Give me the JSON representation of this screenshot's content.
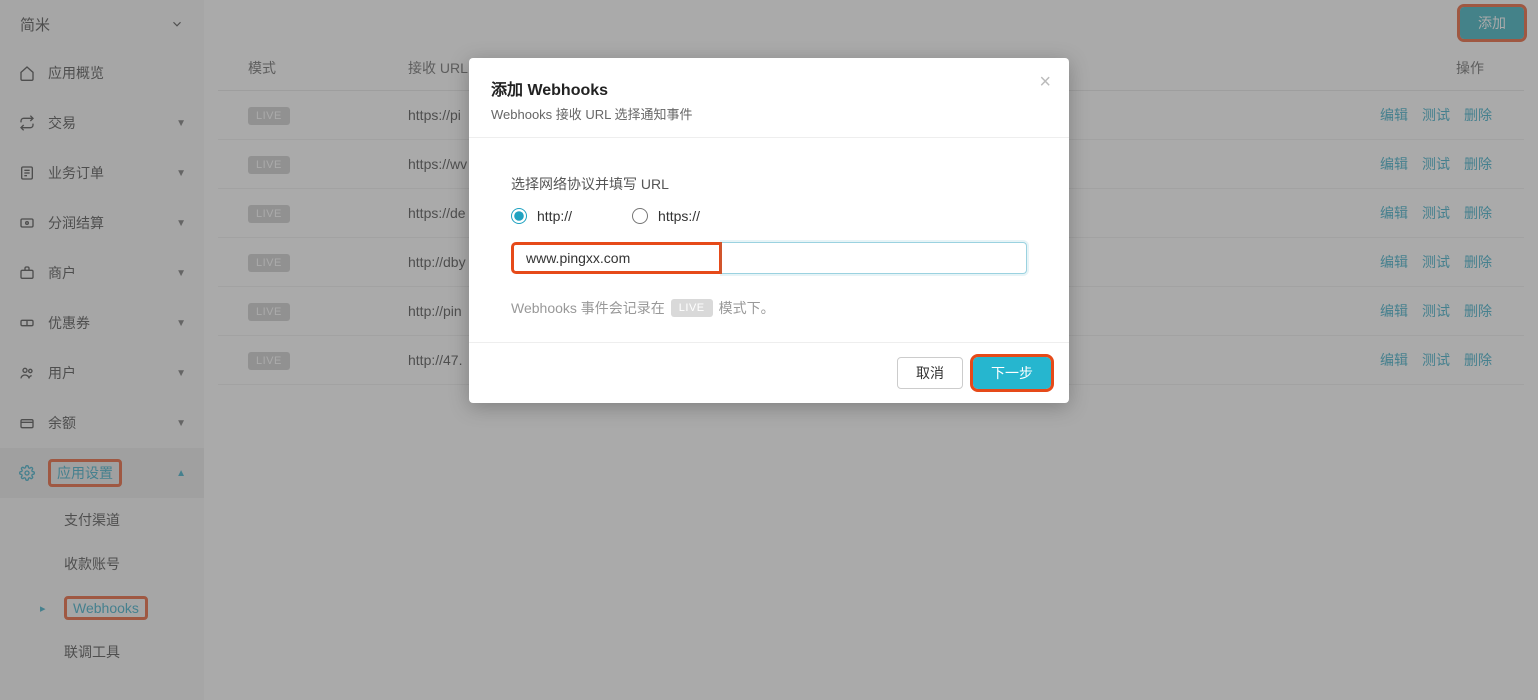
{
  "sidebar": {
    "app_name": "简米",
    "items": [
      {
        "icon": "home-icon",
        "label": "应用概览",
        "has_caret": false
      },
      {
        "icon": "transaction-icon",
        "label": "交易",
        "has_caret": true
      },
      {
        "icon": "order-icon",
        "label": "业务订单",
        "has_caret": true
      },
      {
        "icon": "split-icon",
        "label": "分润结算",
        "has_caret": true
      },
      {
        "icon": "merchant-icon",
        "label": "商户",
        "has_caret": true
      },
      {
        "icon": "coupon-icon",
        "label": "优惠券",
        "has_caret": true
      },
      {
        "icon": "users-icon",
        "label": "用户",
        "has_caret": true
      },
      {
        "icon": "balance-icon",
        "label": "余额",
        "has_caret": true
      },
      {
        "icon": "settings-icon",
        "label": "应用设置",
        "has_caret": true,
        "active": true
      }
    ],
    "sub_items": [
      {
        "label": "支付渠道"
      },
      {
        "label": "收款账号"
      },
      {
        "label": "Webhooks",
        "current": true
      },
      {
        "label": "联调工具"
      }
    ]
  },
  "topbar": {
    "add_label": "添加"
  },
  "table": {
    "headers": {
      "mode": "模式",
      "url": "接收 URL",
      "ops": "操作"
    },
    "live_badge": "LIVE",
    "rows": [
      {
        "url": "https://pi"
      },
      {
        "url": "https://wv"
      },
      {
        "url": "https://de"
      },
      {
        "url": "http://dby"
      },
      {
        "url": "http://pin"
      },
      {
        "url": "http://47."
      }
    ],
    "ops": {
      "edit": "编辑",
      "test": "测试",
      "delete": "删除"
    }
  },
  "modal": {
    "title": "添加 Webhooks",
    "subtitle": "Webhooks 接收 URL 选择通知事件",
    "section_label": "选择网络协议并填写 URL",
    "radio_http": "http://",
    "radio_https": "https://",
    "input_prefix_value": "www.pingxx.com",
    "input_rest_value": "",
    "hint_before": "Webhooks 事件会记录在",
    "hint_badge": "LIVE",
    "hint_after": "模式下。",
    "cancel": "取消",
    "next": "下一步"
  }
}
